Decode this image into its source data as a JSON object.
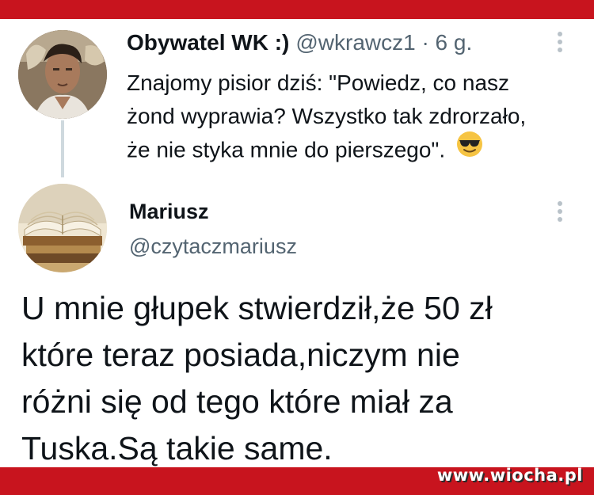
{
  "tweet1": {
    "display_name": "Obywatel WK :)",
    "handle_time": "@wkrawcz1 · 6 g.",
    "lines": [
      "Znajomy pisior dziś:  \"Powiedz, co nasz",
      "żond wyprawia? Wszystko tak zdrorzało,",
      "że nie styka mnie do pierszego\"."
    ],
    "emoji": "sunglasses-smiley"
  },
  "tweet2": {
    "display_name": "Mariusz",
    "handle": "@czytaczmariusz",
    "lines": [
      "U mnie głupek stwierdził,że 50 zł",
      "które teraz posiada,niczym nie",
      "różni się od tego które miał  za",
      "Tuska.Są takie same."
    ]
  },
  "watermark": "www.wiocha.pl",
  "colors": {
    "brand_red": "#c8141e",
    "text_primary": "#0f1419",
    "text_secondary": "#536471",
    "thread_line": "#cfd9de"
  }
}
